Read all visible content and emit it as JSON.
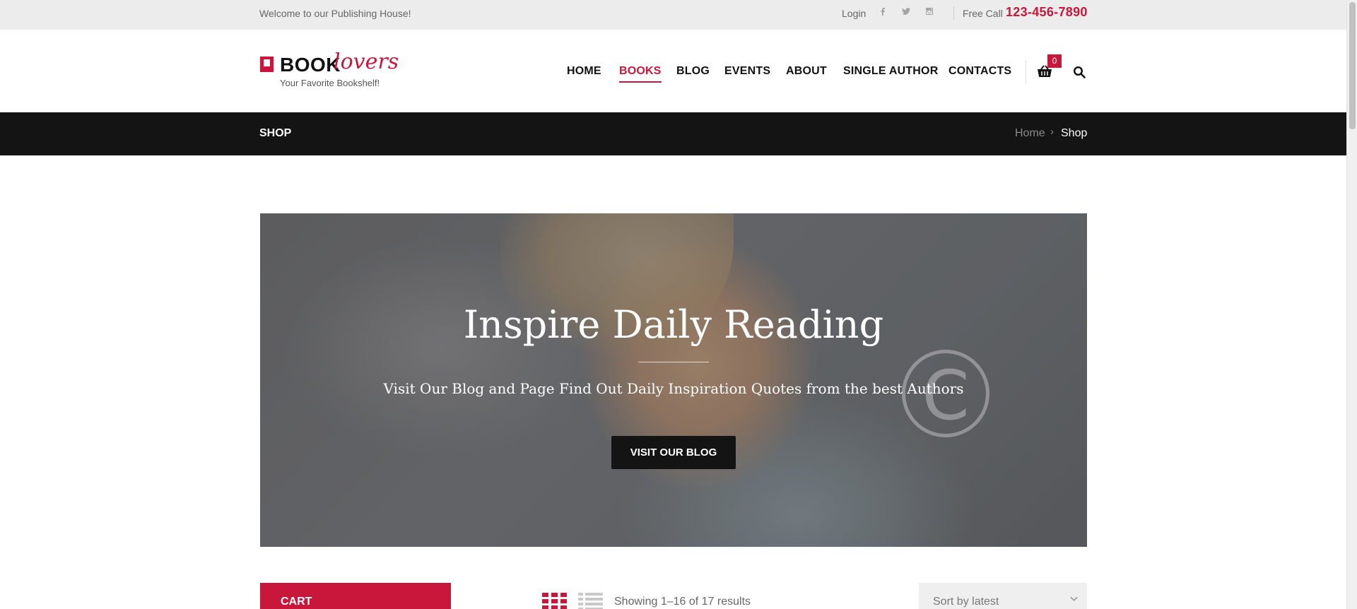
{
  "topbar": {
    "welcome": "Welcome to our Publishing House!",
    "login": "Login",
    "social_icons": [
      "facebook-icon",
      "twitter-icon",
      "instagram-icon"
    ],
    "free_call_label": "Free Call",
    "phone": "123-456-7890"
  },
  "header": {
    "logo": {
      "book": "BOOK",
      "lovers": "lovers",
      "tagline": "Your Favorite Bookshelf!"
    },
    "nav": [
      {
        "label": "Home",
        "active": false
      },
      {
        "label": "Books",
        "active": true
      },
      {
        "label": "Blog",
        "active": false
      },
      {
        "label": "Events",
        "active": false
      },
      {
        "label": "About",
        "active": false
      },
      {
        "label": "Single Author",
        "active": false
      },
      {
        "label": "Contacts",
        "active": false
      }
    ],
    "cart_count": "0",
    "icons": {
      "cart": "basket-icon",
      "search": "search-icon"
    }
  },
  "titlebar": {
    "title": "SHOP",
    "breadcrumb": {
      "home": "Home",
      "separator": "›",
      "current": "Shop"
    }
  },
  "banner": {
    "heading": "Inspire Daily Reading",
    "subheading": "Visit Our Blog and Page Find Out Daily Inspiration Quotes from the best Authors",
    "button": "VISIT OUR BLOG"
  },
  "shop": {
    "cart_widget_title": "CART",
    "results_text": "Showing 1–16 of 17 results",
    "sort_value": "Sort by latest",
    "view_icons": [
      "grid-view-icon",
      "list-view-icon"
    ]
  },
  "colors": {
    "accent": "#c8173b",
    "dark": "#141414",
    "topbar_bg": "#ececec"
  }
}
